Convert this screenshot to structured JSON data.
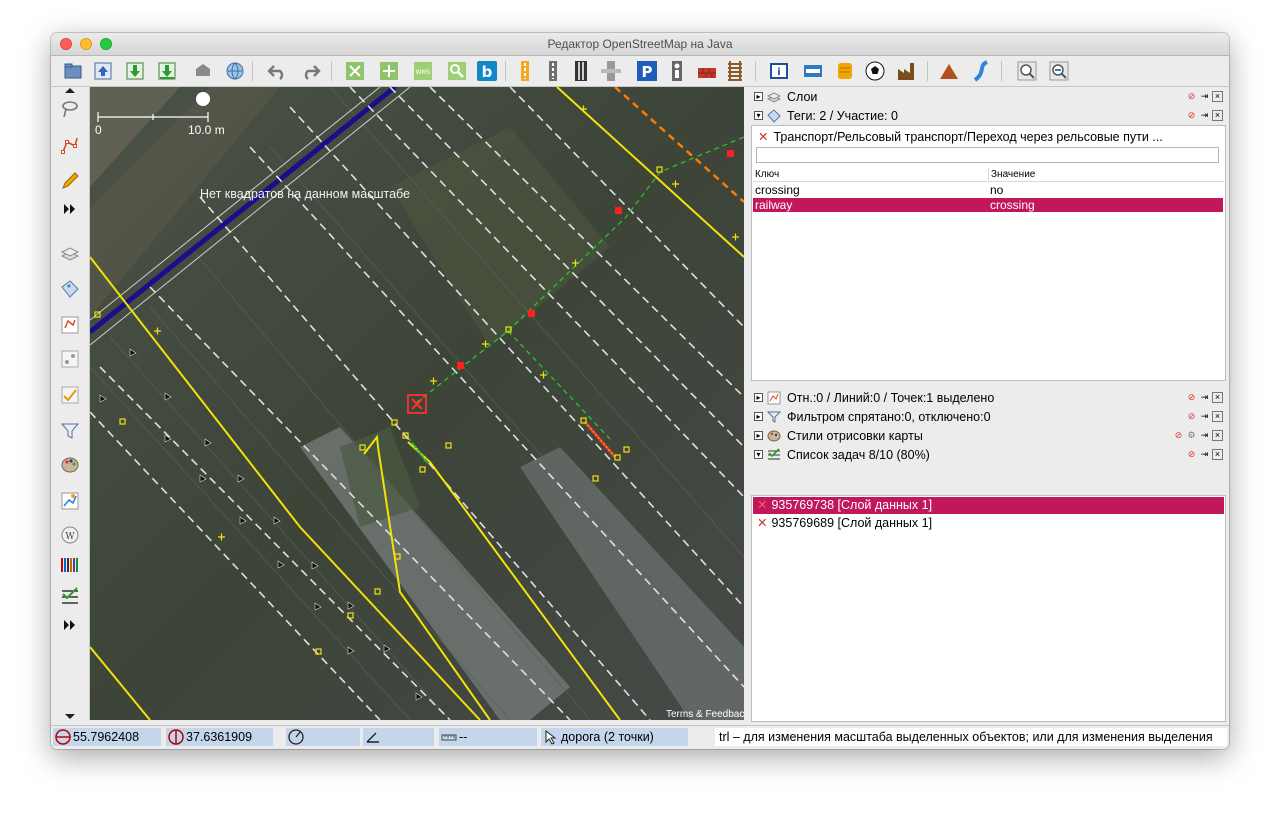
{
  "window": {
    "title": "Редактор OpenStreetMap на Java"
  },
  "toolbar": {
    "items": [
      "open-file-icon",
      "upload-icon",
      "download-icon",
      "download-data-icon",
      "upload-changes-icon",
      "globe-icon",
      "undo-icon",
      "redo-icon",
      "zoom-fit-icon",
      "zoom-selection-icon",
      "wms-icon",
      "search-icon",
      "bing-icon",
      "traffic-light-icon",
      "rail-icon",
      "tram-icon",
      "level-crossing-icon",
      "parking-icon",
      "pedestrian-crossing-icon",
      "wall-icon",
      "railway-icon",
      "info-icon",
      "bed-icon",
      "tourism-icon",
      "football-icon",
      "industrial-icon",
      "peak-icon",
      "waterway-icon",
      "zoom-in-icon",
      "zoom-out-icon"
    ]
  },
  "map": {
    "scale_min": "0",
    "scale_max": "10.0 m",
    "no_imagery_text": "Нет квадратов на данном масштабе",
    "attribution": "Terms & Feedback"
  },
  "panels": {
    "layers": {
      "title": "Слои"
    },
    "tags": {
      "title": "Теги: 2 / Участие: 0",
      "preset_label": "Транспорт/Рельсовый транспорт/Переход через рельсовые пути ...",
      "col_key": "Ключ",
      "col_value": "Значение",
      "rows": [
        {
          "key": "crossing",
          "value": "no"
        },
        {
          "key": "railway",
          "value": "crossing"
        }
      ]
    },
    "selection": {
      "title": "Отн.:0 / Линий:0 / Точек:1 выделено"
    },
    "filter": {
      "title": "Фильтром спрятано:0, отключено:0"
    },
    "map_styles": {
      "title": "Стили отрисовки карты"
    },
    "tasks": {
      "title": "Список задач 8/10 (80%)",
      "items": [
        {
          "label": "935769738 [Слой данных 1]"
        },
        {
          "label": "935769689 [Слой данных 1]"
        }
      ]
    }
  },
  "status": {
    "lat": "55.7962408",
    "lon": "37.6361909",
    "length": "--",
    "element": "дорога (2 точки)",
    "help": "trl – для изменения масштаба выделенных объектов; или для изменения выделения"
  },
  "colors": {
    "selection": "#c2185b",
    "status_field": "#c4d6ec"
  }
}
